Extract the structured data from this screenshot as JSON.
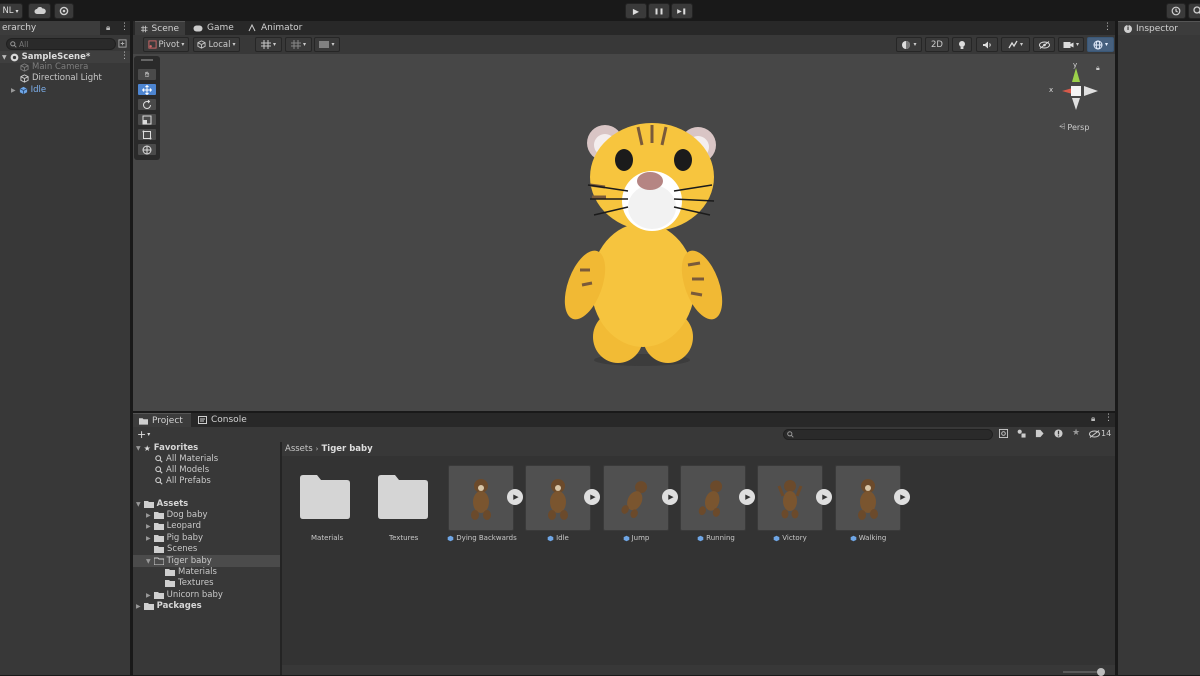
{
  "toolbar": {
    "account_label": "NL",
    "play": "▶",
    "pause": "❚❚",
    "step": "▶❚"
  },
  "hierarchy": {
    "tab_label": "erarchy",
    "search_placeholder": "All",
    "scene": "SampleScene*",
    "items": [
      {
        "label": "Main Camera"
      },
      {
        "label": "Directional Light"
      },
      {
        "label": "Idle"
      }
    ]
  },
  "scene_view": {
    "tabs": [
      "Scene",
      "Game",
      "Animator"
    ],
    "pivot": "Pivot",
    "local": "Local",
    "mode_2d": "2D",
    "gizmo_x": "x",
    "gizmo_y": "y",
    "persp": "Persp"
  },
  "inspector": {
    "tab_label": "Inspector"
  },
  "project": {
    "tabs": [
      "Project",
      "Console"
    ],
    "hidden_count": "14",
    "favorites": {
      "label": "Favorites",
      "items": [
        "All Materials",
        "All Models",
        "All Prefabs"
      ]
    },
    "assets": {
      "label": "Assets",
      "folders": [
        "Dog baby",
        "Leopard",
        "Pig baby",
        "Scenes",
        "Tiger baby"
      ],
      "tiger_children": [
        "Materials",
        "Textures"
      ],
      "after": "Unicorn baby"
    },
    "packages": "Packages",
    "breadcrumb": {
      "root": "Assets",
      "current": "Tiger baby"
    },
    "grid": {
      "folders": [
        "Materials",
        "Textures"
      ],
      "animations": [
        "Dying Backwards",
        "Idle",
        "Jump",
        "Running",
        "Victory",
        "Walking"
      ]
    }
  },
  "colors": {
    "accent": "#4d85d1",
    "scene_bg": "#474747",
    "tiger_body": "#f5c23a"
  }
}
